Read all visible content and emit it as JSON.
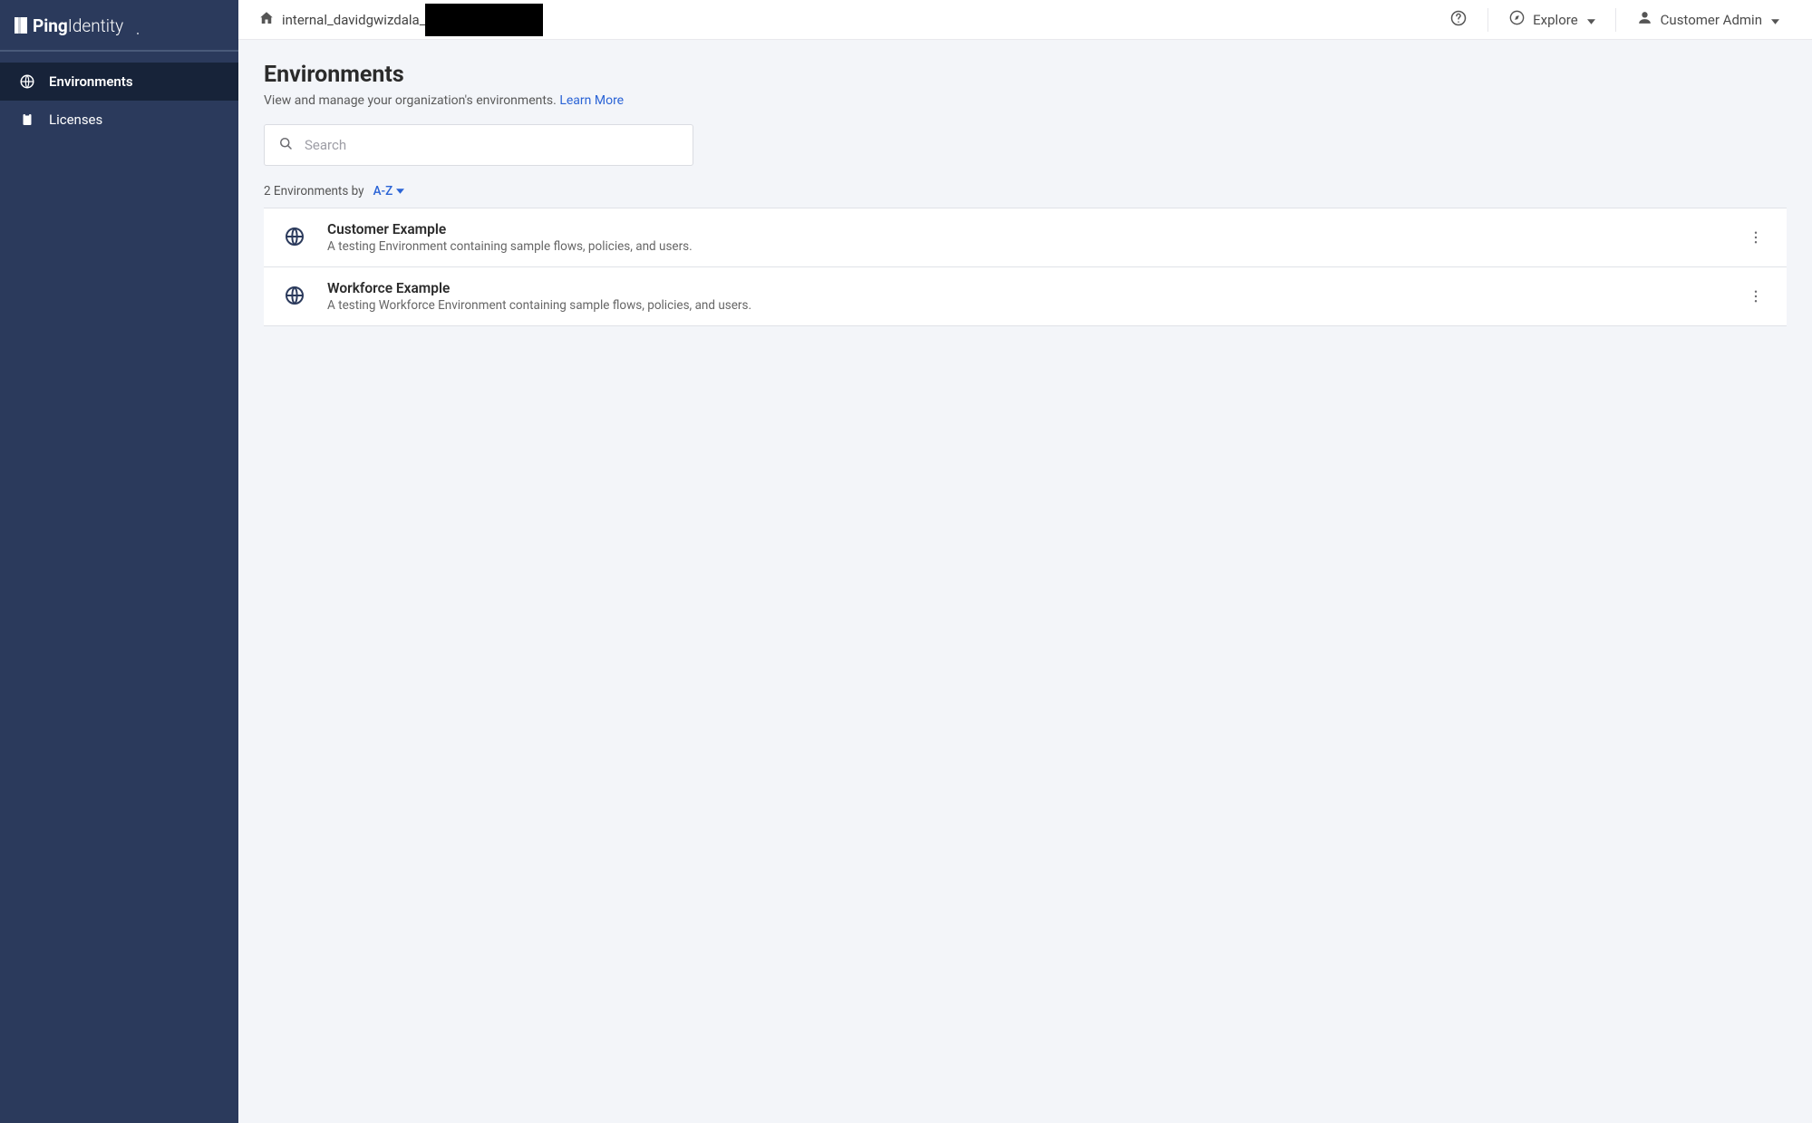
{
  "brand": {
    "name": "PingIdentity."
  },
  "sidebar": {
    "items": [
      {
        "id": "environments",
        "label": "Environments",
        "icon": "globe-ring-icon",
        "active": true
      },
      {
        "id": "licenses",
        "label": "Licenses",
        "icon": "clipboard-icon",
        "active": false
      }
    ]
  },
  "topbar": {
    "breadcrumb_text": "internal_davidgwizdala_",
    "explore_label": "Explore",
    "account_label": "Customer Admin"
  },
  "page": {
    "title": "Environments",
    "subtitle": "View and manage your organization's environments.",
    "learn_more_label": "Learn More",
    "search_placeholder": "Search",
    "count_prefix": "2 Environments by",
    "sort_label": "A-Z"
  },
  "environments": [
    {
      "name": "Customer Example",
      "description": "A testing Environment containing sample flows, policies, and users."
    },
    {
      "name": "Workforce Example",
      "description": "A testing Workforce Environment containing sample flows, policies, and users."
    }
  ]
}
